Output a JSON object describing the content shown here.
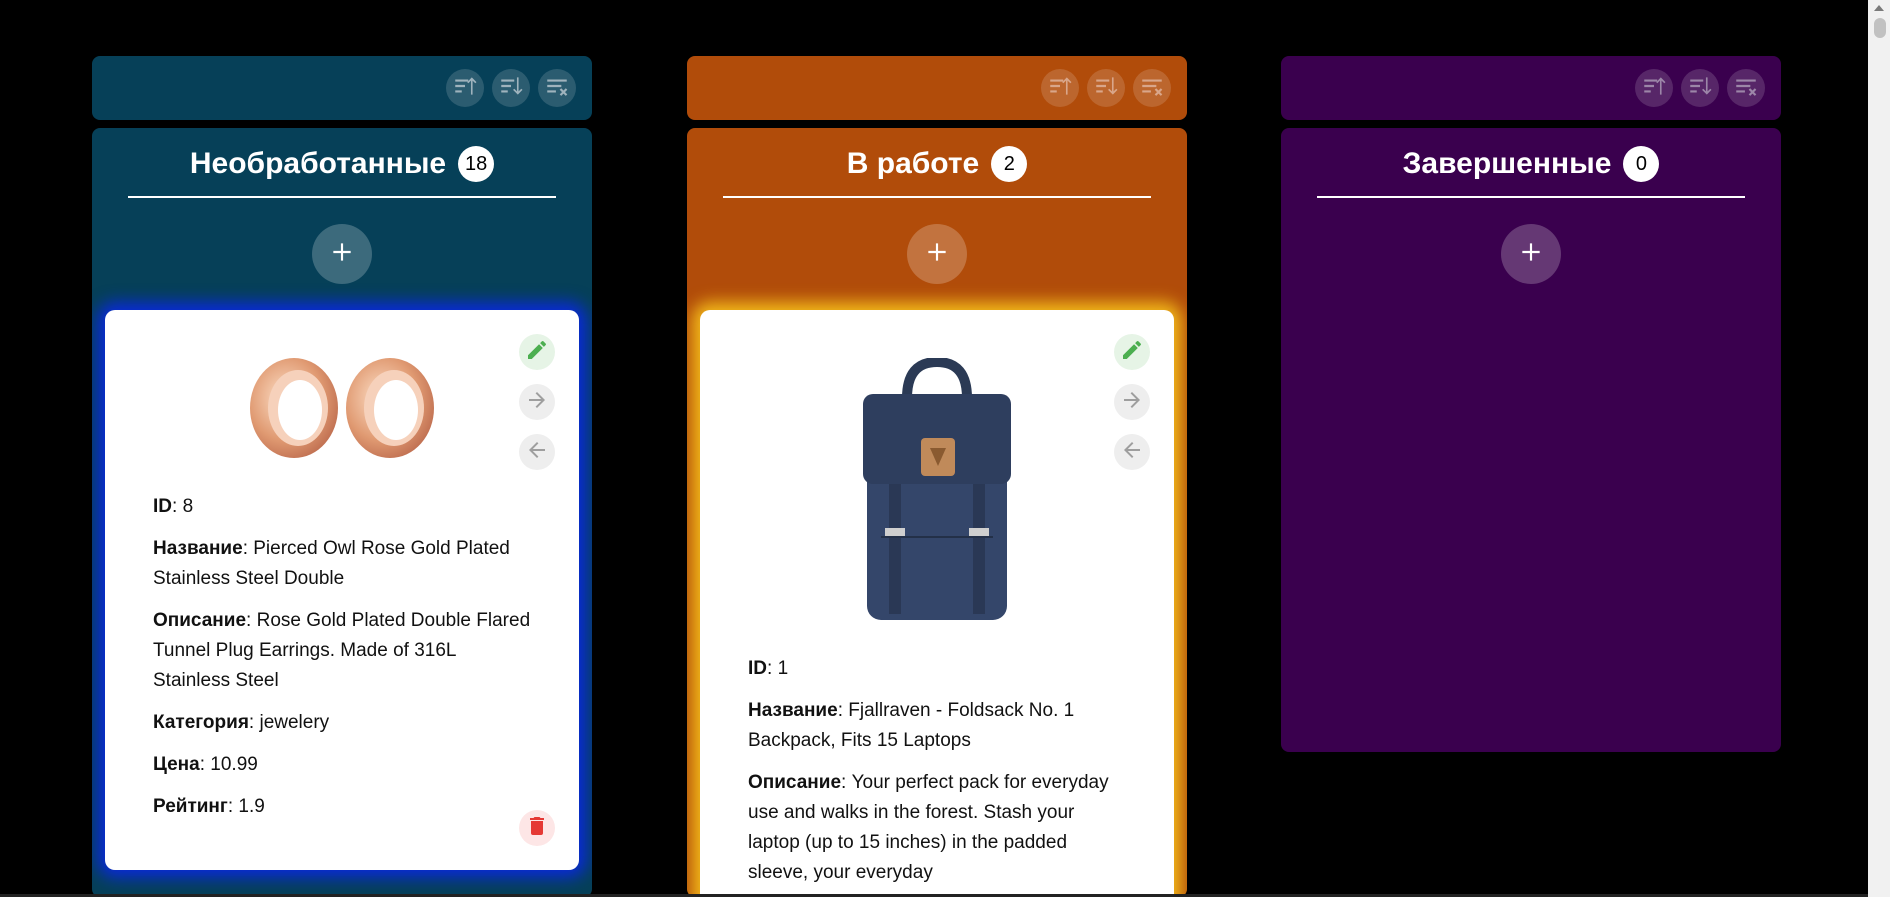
{
  "colors": {
    "background": "#000000",
    "todo": "#064058",
    "todo_glow": "#0a2ad8",
    "inprogress": "#b14c0a",
    "inprogress_glow": "#f2b81a",
    "done": "#3a004e",
    "edit_icon": "#4caf50",
    "delete_icon": "#e53935"
  },
  "icons": {
    "sort_asc": "sort-ascending-icon",
    "sort_desc": "sort-descending-icon",
    "clear_sort": "clear-sort-icon",
    "add": "plus-icon",
    "edit": "pencil-icon",
    "move_right": "arrow-right-icon",
    "move_left": "arrow-left-icon",
    "delete": "trash-icon"
  },
  "columns": [
    {
      "title": "Необработанные",
      "count": "18",
      "card": {
        "image": "rose-gold-tunnel-plug-earrings",
        "id_label": "ID",
        "id": "8",
        "name_label": "Название",
        "name": "Pierced Owl Rose Gold Plated Stainless Steel Double",
        "desc_label": "Описание",
        "desc": "Rose Gold Plated Double Flared Tunnel Plug Earrings. Made of 316L Stainless Steel",
        "category_label": "Категория",
        "category": "jewelery",
        "price_label": "Цена",
        "price": "10.99",
        "rating_label": "Рейтинг",
        "rating": "1.9"
      }
    },
    {
      "title": "В работе",
      "count": "2",
      "card": {
        "image": "navy-backpack",
        "id_label": "ID",
        "id": "1",
        "name_label": "Название",
        "name": "Fjallraven - Foldsack No. 1 Backpack, Fits 15 Laptops",
        "desc_label": "Описание",
        "desc": "Your perfect pack for everyday use and walks in the forest. Stash your laptop (up to 15 inches) in the padded sleeve, your everyday"
      }
    },
    {
      "title": "Завершенные",
      "count": "0"
    }
  ]
}
